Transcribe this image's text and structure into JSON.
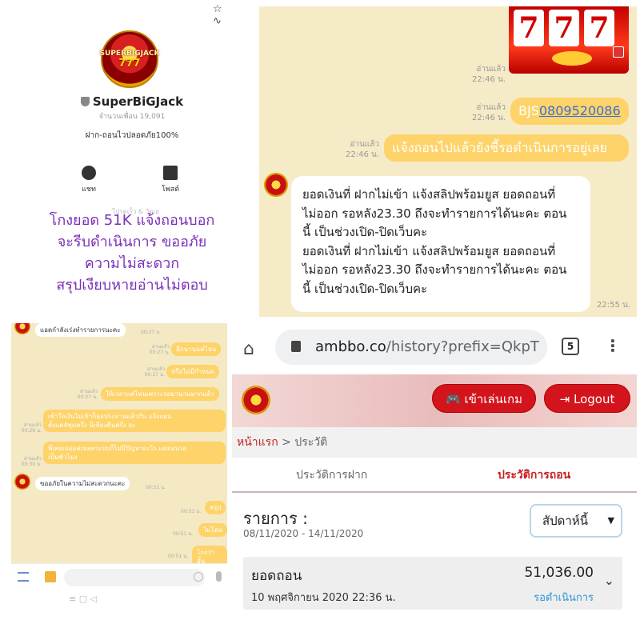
{
  "panel_profile": {
    "top_icons": "☆ ∿",
    "logo_text_1": "SUPERBIGJACK",
    "logo_text_2": "777",
    "name": "SuperBiGJack",
    "friends": "จำนวนเพื่อน 19,091",
    "status": "ฝาก-ถอนไวปลอดภัย100%",
    "buttons": [
      {
        "label": "แชท",
        "icon": "chat-icon"
      },
      {
        "label": "โพสต์",
        "icon": "post-icon"
      }
    ],
    "faint_text": "โปรดเร็ว & วัดเอ",
    "warning_lines": [
      "โกงยอด 51K แจ้งถอนบอก",
      "จะรีบดำเนินการ ขออภัย",
      "ความไม่สะดวก",
      "สรุปเงียบหายอ่านไม่ตอบ"
    ]
  },
  "panel_chat_top": {
    "slot_reels": [
      "7",
      "7",
      "7"
    ],
    "messages": [
      {
        "read": "อ่านแล้ว",
        "time": "22:46 น."
      },
      {
        "read": "อ่านแล้ว",
        "time": "22:46 น.",
        "prefix": "BJS",
        "phone": "0809520086"
      },
      {
        "read": "อ่านแล้ว",
        "time": "22:46 น.",
        "text": "แจ้งถอนไปแล้วยังชี้รอดำเนินการอยู่เลย"
      }
    ],
    "reply_lines": [
      "ยอดเงินที่ ฝากไม่เข้า แจ้งสลิปพร้อมยูส ยอดถอนที่",
      "ไม่ออก รอหลัง23.30 ถึงจะทำรายการได้นะคะ ตอน",
      "นี้ เป็นช่วงเปิด-ปิดเว็บคะ",
      "ยอดเงินที่ ฝากไม่เข้า แจ้งสลิปพร้อมยูส ยอดถอนที่",
      "ไม่ออก รอหลัง23.30 ถึงจะทำรายการได้นะคะ ตอน",
      "นี้ เป็นช่วงเปิด-ปิดเว็บคะ"
    ],
    "reply_time": "22:55 น."
  },
  "panel_chat_bottom": {
    "msg1": "แอดกำลังเร่งทำรายการนะคะ",
    "t1": "00:27 น.",
    "y1": "อีกนานแค่ไหน",
    "r1": "อ่านแล้ว",
    "ty1": "00:27 น.",
    "y2": "หรือไม่มีกำหนด",
    "r2": "อ่านแล้ว",
    "ty2": "00:27 น.",
    "y3": "ให้เวลาแค่ไหนเพราะรอมานานมากแล้ว",
    "r3": "อ่านแล้ว",
    "ty3": "00:27 น.",
    "y4a": "เข้าใจเงินไม่เข้าก็ออประจานแล้วกัน แจ้งถอน",
    "y4b": "ตั้งแต่4ทุ่มครึ่ง นี่เที่ยงคืนครึ่ง ละ",
    "r4": "อ่านแล้ว",
    "ty4": "00:29 น.",
    "y5a": "พี่เคยเจอแต่เหลดระบบก็ไม่มีปัญหาอะไร แต่ถอนรอ",
    "y5b": "เป็นชั่วโมง",
    "r5": "อ่านแล้ว",
    "ty5": "00:30 น.",
    "msg2": "ขออภัยในความไม่สะดวกนะคะ",
    "t2": "00:51 น.",
    "y6": "สรุป",
    "ty6": "00:51 น.",
    "y7": "ไม่โอน",
    "ty7": "00:51 น.",
    "y8": "โกงว่าอั้น",
    "ty8": "00:51 น.",
    "nav": "≡    ▢    ◁"
  },
  "panel_browser": {
    "url_domain": "ambbo.co",
    "url_path": "/history?prefix=QkpT",
    "tab_count": "5",
    "play_button": "เข้าเล่นเกม",
    "logout_button": "Logout",
    "crumb_home": "หน้าแรก",
    "crumb_sep": ">",
    "crumb_current": "ประวัติ",
    "tab_deposit": "ประวัติการฝาก",
    "tab_withdraw": "ประวัติการถอน",
    "list_title": "รายการ :",
    "date_range": "08/11/2020 - 14/11/2020",
    "period_select": "สัปดาห์นี้",
    "row": {
      "label": "ยอดถอน",
      "date": "10 พฤศจิกายน 2020 22:36 น.",
      "amount": "51,036.00",
      "status": "รอดำเนินการ"
    },
    "status_color": "#2d97d8",
    "accent_color": "#d4141c"
  }
}
